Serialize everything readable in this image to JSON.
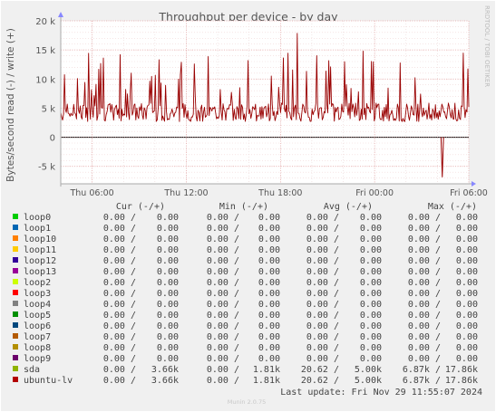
{
  "chart_data": {
    "type": "line",
    "title": "Throughput per device - by day",
    "ylabel": "Bytes/second read (-) / write (+)",
    "ylim": [
      -8000,
      20000
    ],
    "y_ticks": [
      {
        "value": 20000,
        "label": "20 k"
      },
      {
        "value": 15000,
        "label": "15 k"
      },
      {
        "value": 10000,
        "label": "10 k"
      },
      {
        "value": 5000,
        "label": "5 k"
      },
      {
        "value": 0,
        "label": "0"
      },
      {
        "value": -5000,
        "label": "-5 k"
      }
    ],
    "x_range_hours": [
      0,
      26
    ],
    "x_ticks": [
      {
        "hour": 2,
        "label": "Thu 06:00"
      },
      {
        "hour": 8,
        "label": "Thu 12:00"
      },
      {
        "hour": 14,
        "label": "Thu 18:00"
      },
      {
        "hour": 20,
        "label": "Fri 00:00"
      },
      {
        "hour": 26,
        "label": "Fri 06:00"
      }
    ],
    "series": [
      {
        "name": "ubuntu-lv",
        "color": "#990000",
        "write_avg": 5000,
        "write_max": 17860,
        "read_min": -6870
      }
    ],
    "grid": true,
    "side_text": "RRDTOOL / TOBI OETIKER"
  },
  "legend": {
    "headers": {
      "cur": "Cur (-/+)",
      "min": "Min (-/+)",
      "avg": "Avg (-/+)",
      "max": "Max (-/+)"
    },
    "rows": [
      {
        "name": "loop0",
        "color": "#00cc00",
        "cur_r": "0.00",
        "cur_w": "0.00",
        "min_r": "0.00",
        "min_w": "0.00",
        "avg_r": "0.00",
        "avg_w": "0.00",
        "max_r": "0.00",
        "max_w": "0.00"
      },
      {
        "name": "loop1",
        "color": "#0066b3",
        "cur_r": "0.00",
        "cur_w": "0.00",
        "min_r": "0.00",
        "min_w": "0.00",
        "avg_r": "0.00",
        "avg_w": "0.00",
        "max_r": "0.00",
        "max_w": "0.00"
      },
      {
        "name": "loop10",
        "color": "#ff8000",
        "cur_r": "0.00",
        "cur_w": "0.00",
        "min_r": "0.00",
        "min_w": "0.00",
        "avg_r": "0.00",
        "avg_w": "0.00",
        "max_r": "0.00",
        "max_w": "0.00"
      },
      {
        "name": "loop11",
        "color": "#ffcc00",
        "cur_r": "0.00",
        "cur_w": "0.00",
        "min_r": "0.00",
        "min_w": "0.00",
        "avg_r": "0.00",
        "avg_w": "0.00",
        "max_r": "0.00",
        "max_w": "0.00"
      },
      {
        "name": "loop12",
        "color": "#330099",
        "cur_r": "0.00",
        "cur_w": "0.00",
        "min_r": "0.00",
        "min_w": "0.00",
        "avg_r": "0.00",
        "avg_w": "0.00",
        "max_r": "0.00",
        "max_w": "0.00"
      },
      {
        "name": "loop13",
        "color": "#990099",
        "cur_r": "0.00",
        "cur_w": "0.00",
        "min_r": "0.00",
        "min_w": "0.00",
        "avg_r": "0.00",
        "avg_w": "0.00",
        "max_r": "0.00",
        "max_w": "0.00"
      },
      {
        "name": "loop2",
        "color": "#ccff00",
        "cur_r": "0.00",
        "cur_w": "0.00",
        "min_r": "0.00",
        "min_w": "0.00",
        "avg_r": "0.00",
        "avg_w": "0.00",
        "max_r": "0.00",
        "max_w": "0.00"
      },
      {
        "name": "loop3",
        "color": "#ff0000",
        "cur_r": "0.00",
        "cur_w": "0.00",
        "min_r": "0.00",
        "min_w": "0.00",
        "avg_r": "0.00",
        "avg_w": "0.00",
        "max_r": "0.00",
        "max_w": "0.00"
      },
      {
        "name": "loop4",
        "color": "#808080",
        "cur_r": "0.00",
        "cur_w": "0.00",
        "min_r": "0.00",
        "min_w": "0.00",
        "avg_r": "0.00",
        "avg_w": "0.00",
        "max_r": "0.00",
        "max_w": "0.00"
      },
      {
        "name": "loop5",
        "color": "#008f00",
        "cur_r": "0.00",
        "cur_w": "0.00",
        "min_r": "0.00",
        "min_w": "0.00",
        "avg_r": "0.00",
        "avg_w": "0.00",
        "max_r": "0.00",
        "max_w": "0.00"
      },
      {
        "name": "loop6",
        "color": "#00487d",
        "cur_r": "0.00",
        "cur_w": "0.00",
        "min_r": "0.00",
        "min_w": "0.00",
        "avg_r": "0.00",
        "avg_w": "0.00",
        "max_r": "0.00",
        "max_w": "0.00"
      },
      {
        "name": "loop7",
        "color": "#b35a00",
        "cur_r": "0.00",
        "cur_w": "0.00",
        "min_r": "0.00",
        "min_w": "0.00",
        "avg_r": "0.00",
        "avg_w": "0.00",
        "max_r": "0.00",
        "max_w": "0.00"
      },
      {
        "name": "loop8",
        "color": "#b38f00",
        "cur_r": "0.00",
        "cur_w": "0.00",
        "min_r": "0.00",
        "min_w": "0.00",
        "avg_r": "0.00",
        "avg_w": "0.00",
        "max_r": "0.00",
        "max_w": "0.00"
      },
      {
        "name": "loop9",
        "color": "#6b006b",
        "cur_r": "0.00",
        "cur_w": "0.00",
        "min_r": "0.00",
        "min_w": "0.00",
        "avg_r": "0.00",
        "avg_w": "0.00",
        "max_r": "0.00",
        "max_w": "0.00"
      },
      {
        "name": "sda",
        "color": "#8fb300",
        "cur_r": "0.00",
        "cur_w": "3.66k",
        "min_r": "0.00",
        "min_w": "1.81k",
        "avg_r": "20.62",
        "avg_w": "5.00k",
        "max_r": "6.87k",
        "max_w": "17.86k"
      },
      {
        "name": "ubuntu-lv",
        "color": "#b30000",
        "cur_r": "0.00",
        "cur_w": "3.66k",
        "min_r": "0.00",
        "min_w": "1.81k",
        "avg_r": "20.62",
        "avg_w": "5.00k",
        "max_r": "6.87k",
        "max_w": "17.86k"
      }
    ]
  },
  "last_update": "Last update:  Fri Nov 29 11:55:07 2024",
  "footer": "Munin 2.0.75"
}
